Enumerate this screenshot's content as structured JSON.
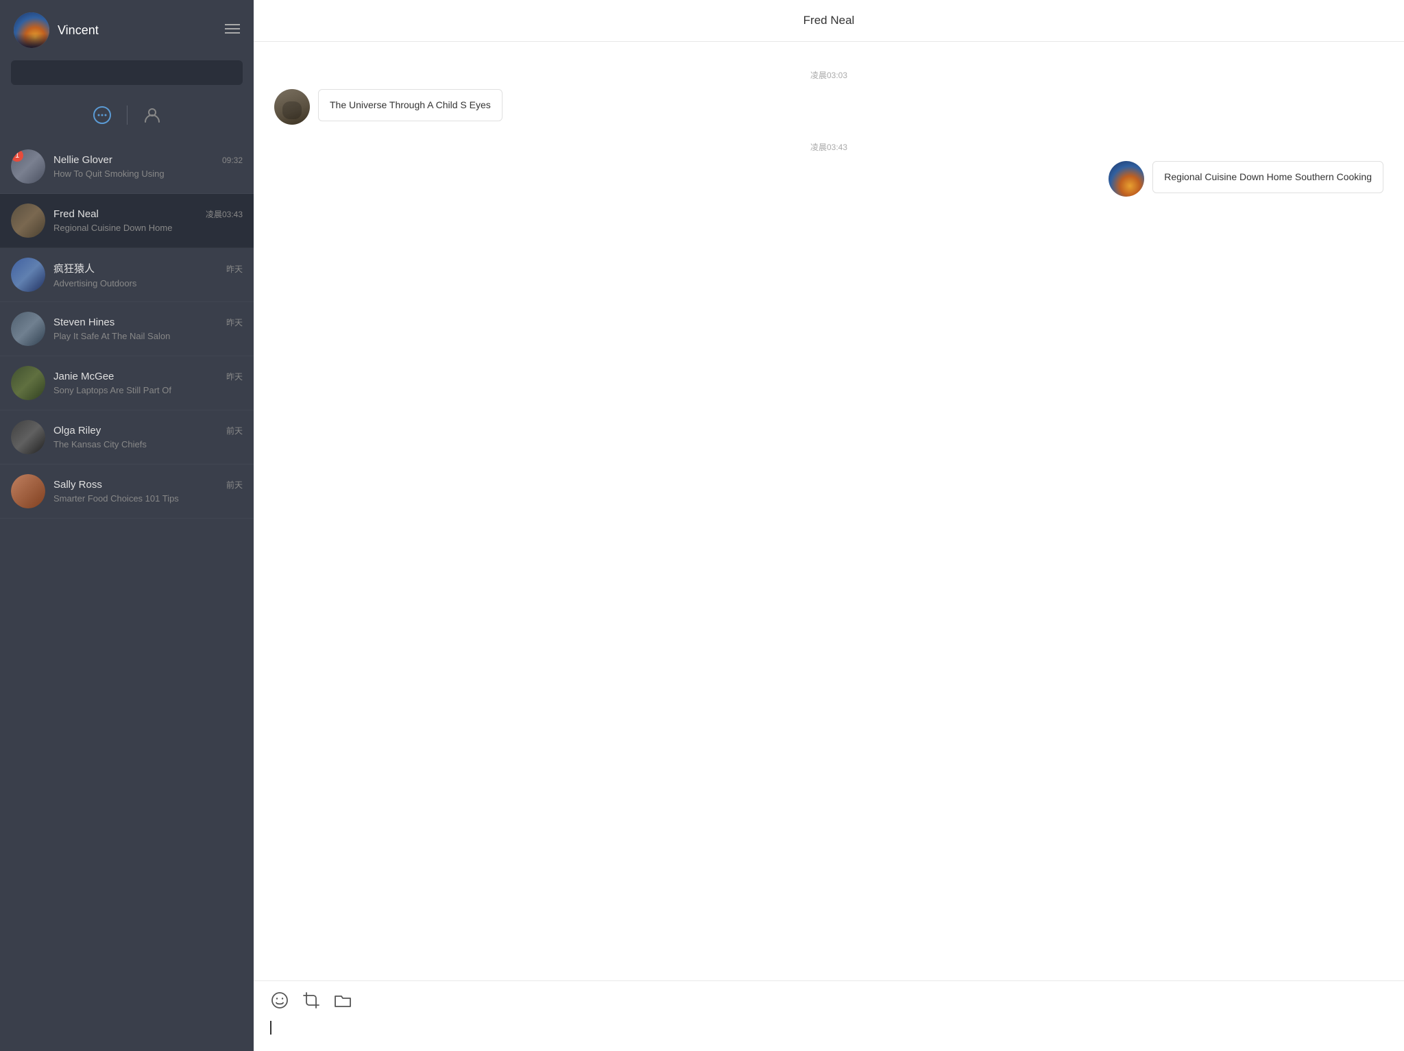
{
  "sidebar": {
    "username": "Vincent",
    "tabs": {
      "chat_label": "chat",
      "contacts_label": "contacts"
    },
    "contacts": [
      {
        "id": "nellie-glover",
        "name": "Nellie Glover",
        "time": "09:32",
        "preview": "How To Quit Smoking Using",
        "badge": "1",
        "avatar_class": "av-nellie"
      },
      {
        "id": "fred-neal",
        "name": "Fred Neal",
        "time": "凌晨03:43",
        "preview": "Regional Cuisine Down Home",
        "badge": "",
        "avatar_class": "av-fred",
        "active": true
      },
      {
        "id": "crazy-monkey",
        "name": "疯狂猿人",
        "time": "昨天",
        "preview": "Advertising Outdoors",
        "badge": "",
        "avatar_class": "av-crazy"
      },
      {
        "id": "steven-hines",
        "name": "Steven Hines",
        "time": "昨天",
        "preview": "Play It Safe At The Nail Salon",
        "badge": "",
        "avatar_class": "av-steven"
      },
      {
        "id": "janie-mcgee",
        "name": "Janie McGee",
        "time": "昨天",
        "preview": "Sony Laptops Are Still Part Of",
        "badge": "",
        "avatar_class": "av-janie"
      },
      {
        "id": "olga-riley",
        "name": "Olga Riley",
        "time": "前天",
        "preview": "The Kansas City Chiefs",
        "badge": "",
        "avatar_class": "av-olga"
      },
      {
        "id": "sally-ross",
        "name": "Sally Ross",
        "time": "前天",
        "preview": "Smarter Food Choices 101 Tips",
        "badge": "",
        "avatar_class": "av-sally"
      }
    ]
  },
  "chat": {
    "title": "Fred Neal",
    "messages": [
      {
        "id": "msg-1",
        "timestamp": "凌晨03:03",
        "type": "incoming",
        "text": "The Universe Through A Child S Eyes"
      },
      {
        "id": "msg-2",
        "timestamp": "凌晨03:43",
        "type": "outgoing",
        "text": "Regional Cuisine Down Home Southern Cooking"
      }
    ],
    "footer": {
      "emoji_label": "emoji",
      "crop_label": "crop",
      "folder_label": "folder"
    }
  }
}
